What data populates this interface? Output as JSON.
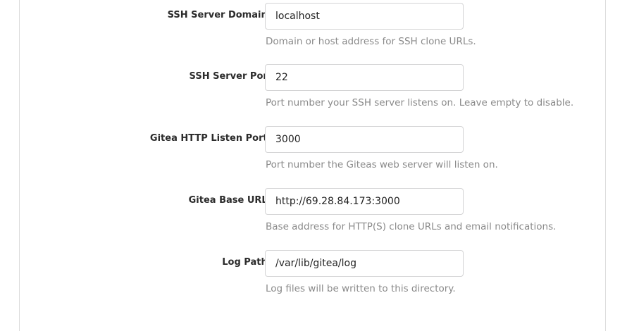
{
  "form": {
    "fields": [
      {
        "label": "SSH Server Domain",
        "required": "*",
        "value": "localhost",
        "help": "Domain or host address for SSH clone URLs."
      },
      {
        "label": "SSH Server Port",
        "required": "",
        "value": "22",
        "help": "Port number your SSH server listens on. Leave empty to disable."
      },
      {
        "label": "Gitea HTTP Listen Port",
        "required": "*",
        "value": "3000",
        "help": "Port number the Giteas web server will listen on."
      },
      {
        "label": "Gitea Base URL",
        "required": "*",
        "value": "http://69.28.84.173:3000",
        "help": "Base address for HTTP(S) clone URLs and email notifications."
      },
      {
        "label": "Log Path",
        "required": "*",
        "value": "/var/lib/gitea/log",
        "help": "Log files will be written to this directory."
      }
    ]
  },
  "colors": {
    "required": "#db2828",
    "help_text": "#8a8a8a",
    "border": "#d4d4d5"
  }
}
